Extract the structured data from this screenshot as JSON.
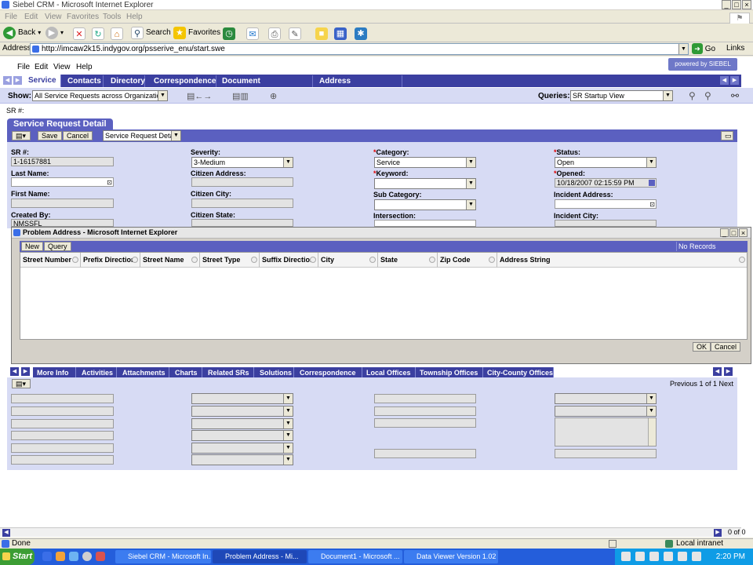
{
  "window": {
    "title": "Siebel CRM - Microsoft Internet Explorer"
  },
  "ie_menu": [
    "File",
    "Edit",
    "View",
    "Favorites",
    "Tools",
    "Help"
  ],
  "ie_toolbar": {
    "back": "Back",
    "search": "Search",
    "favorites": "Favorites"
  },
  "address": {
    "label": "Address",
    "url": "http://imcaw2k15.indygov.org/psserive_enu/start.swe",
    "go": "Go",
    "links": "Links"
  },
  "app_menu": [
    "File",
    "Edit",
    "View",
    "Help"
  ],
  "brand": "powered by SIEBEL eBusiness",
  "tabs": [
    "Service",
    "Contacts",
    "Directory",
    "Correspondence",
    "Document Administration",
    "Address Administration"
  ],
  "showbar": {
    "show_label": "Show:",
    "show_value": "All Service Requests across Organizations",
    "queries_label": "Queries:",
    "queries_value": "SR Startup View"
  },
  "sr_label": "SR #:",
  "applet": {
    "title": "Service Request Detail",
    "save": "Save",
    "cancel": "Cancel",
    "view_select": "Service Request Detail"
  },
  "form": {
    "sr_label": "SR #:",
    "sr_value": "1-16157881",
    "last_name": "Last Name:",
    "first_name": "First Name:",
    "created_by": "Created By:",
    "created_by_value": "NMSSFL",
    "severity": "Severity:",
    "severity_value": "3-Medium",
    "citizen_address": "Citizen Address:",
    "citizen_city": "Citizen City:",
    "citizen_state": "Citizen State:",
    "category": "Category:",
    "category_value": "Service",
    "keyword": "Keyword:",
    "sub_category": "Sub Category:",
    "intersection": "Intersection:",
    "status": "Status:",
    "status_value": "Open",
    "opened": "Opened:",
    "opened_value": "10/18/2007 02:15:59 PM",
    "incident_address": "Incident Address:",
    "incident_city": "Incident City:",
    "required_mark": "*"
  },
  "popup": {
    "title": "Problem Address - Microsoft Internet Explorer",
    "new": "New",
    "query": "Query",
    "no_records": "No Records",
    "columns": [
      "Street Number",
      "Prefix Direction",
      "Street Name",
      "Street Type",
      "Suffix Direction",
      "City",
      "State",
      "Zip Code",
      "Address String"
    ],
    "ok": "OK",
    "cancel": "Cancel"
  },
  "lower_tabs": [
    "More Info",
    "Activities",
    "Attachments",
    "Charts",
    "Related SRs",
    "Solutions",
    "Correspondence",
    "Local Offices",
    "Township Offices",
    "City-County Offices"
  ],
  "pager": "Previous 1 of 1 Next",
  "bottom_counter": "0 of 0",
  "status": {
    "text": "Done",
    "zone": "Local intranet"
  },
  "taskbar": {
    "start": "Start",
    "tasks": [
      "Siebel CRM - Microsoft In...",
      "Problem Address - Mi...",
      "Document1 - Microsoft ...",
      "Data Viewer Version 1.02"
    ],
    "time": "2:20 PM"
  }
}
